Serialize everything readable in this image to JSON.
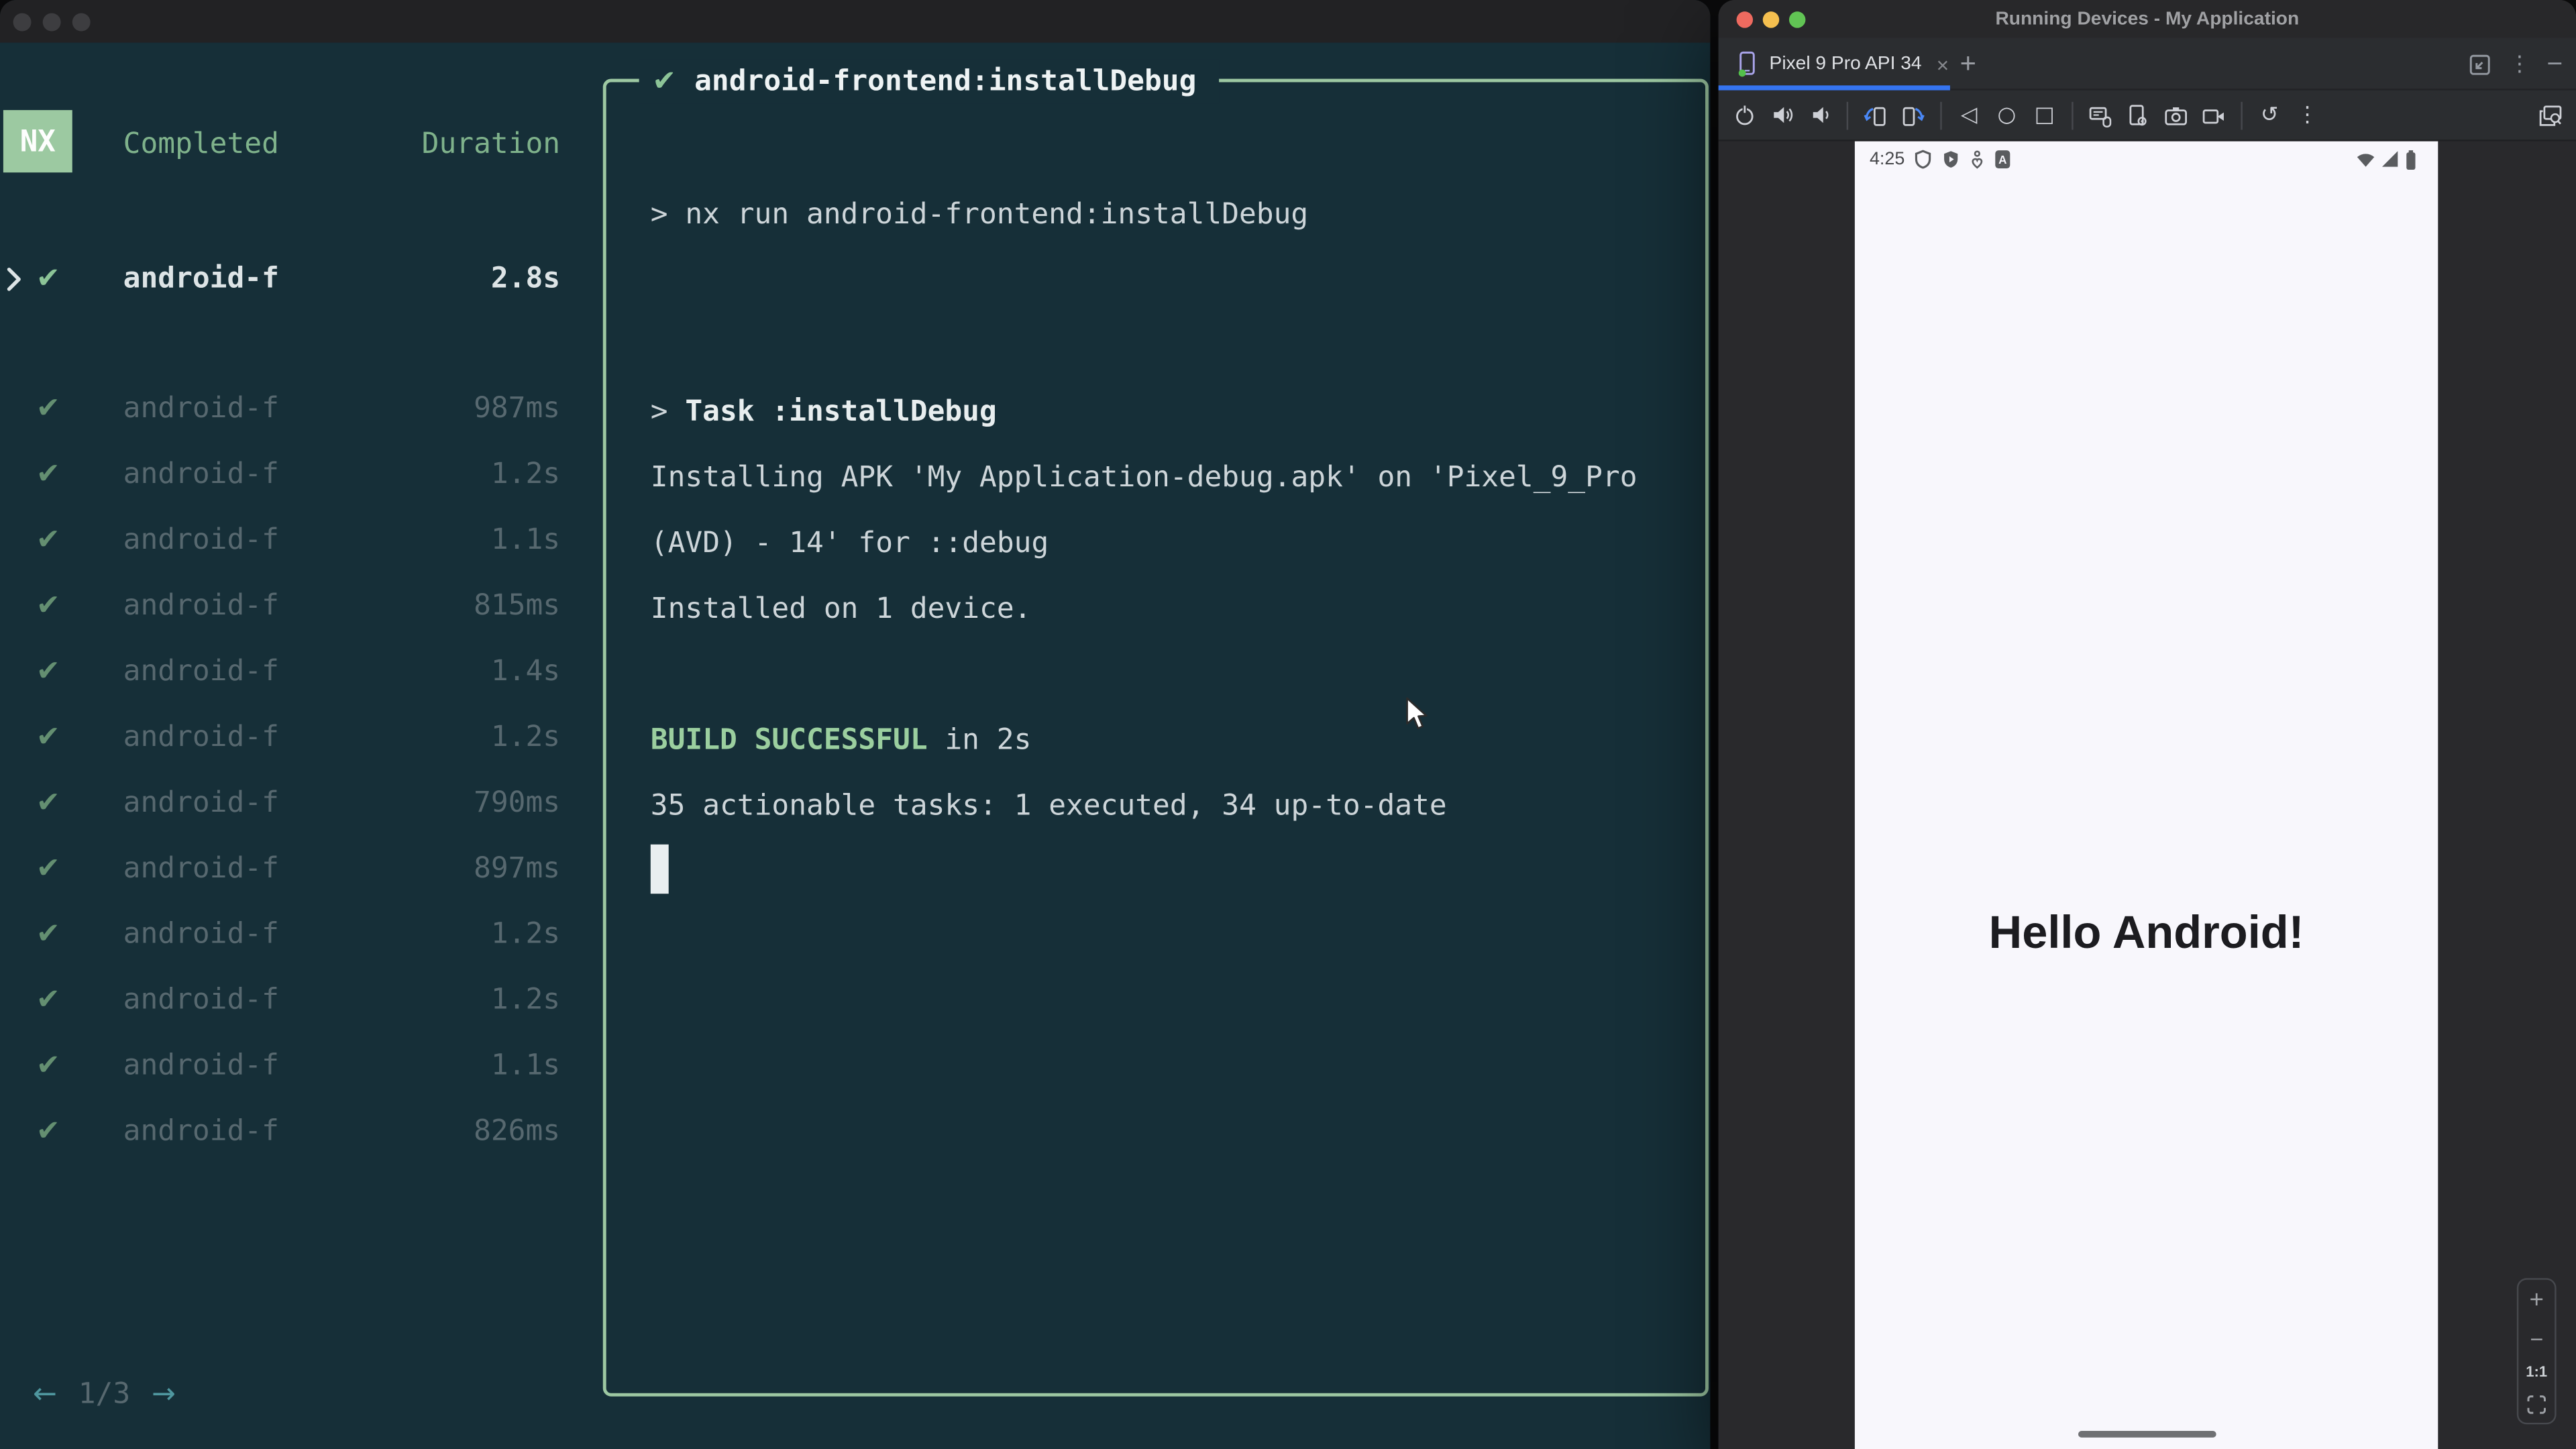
{
  "terminal": {
    "logo": "NX",
    "check_glyph": "✔",
    "header": {
      "completed": "Completed",
      "duration": "Duration"
    },
    "focused": {
      "name": "android-f",
      "duration": "2.8s"
    },
    "tasks": [
      {
        "name": "android-f",
        "duration": "987ms"
      },
      {
        "name": "android-f",
        "duration": "1.2s"
      },
      {
        "name": "android-f",
        "duration": "1.1s"
      },
      {
        "name": "android-f",
        "duration": "815ms"
      },
      {
        "name": "android-f",
        "duration": "1.4s"
      },
      {
        "name": "android-f",
        "duration": "1.2s"
      },
      {
        "name": "android-f",
        "duration": "790ms"
      },
      {
        "name": "android-f",
        "duration": "897ms"
      },
      {
        "name": "android-f",
        "duration": "1.2s"
      },
      {
        "name": "android-f",
        "duration": "1.2s"
      },
      {
        "name": "android-f",
        "duration": "1.1s"
      },
      {
        "name": "android-f",
        "duration": "826ms"
      }
    ],
    "pagination": {
      "prev": "←",
      "current": "1/3",
      "next": "→"
    },
    "output": {
      "title": "android-frontend:installDebug",
      "prompt": ">",
      "command": "nx run android-frontend:installDebug",
      "task_line": "Task :installDebug",
      "install_line1": "Installing APK 'My Application-debug.apk' on 'Pixel_9_Pro",
      "install_line2": "(AVD) - 14' for ::debug",
      "install_line3": "Installed on 1 device.",
      "build_status": "BUILD SUCCESSFUL",
      "build_suffix": "in 2s",
      "summary": "35 actionable tasks: 1 executed, 34 up-to-date"
    },
    "colors": {
      "background": "#162f38",
      "accent_green": "#9dc8a2",
      "dim_text": "#57686f",
      "bright_text": "#dde4e6",
      "teal_arrow": "#4f979f"
    }
  },
  "studio": {
    "window_title": "Running Devices - My Application",
    "tab": {
      "label": "Pixel 9 Pro API 34",
      "close_glyph": "×",
      "add_glyph": "+"
    },
    "window_controls": {
      "more_glyph": "⋮",
      "minimize_glyph": "─"
    },
    "toolbar": {
      "icons": [
        "power",
        "volume-up",
        "volume-down",
        "rotate-left",
        "rotate-right",
        "back",
        "home",
        "overview",
        "hardware-input",
        "device-settings",
        "screenshot-camera",
        "screen-record",
        "reset",
        "more-options",
        "device-search"
      ],
      "back_glyph": "◁",
      "home_glyph": "○",
      "overview_glyph": "□",
      "reset_glyph": "↺",
      "more_glyph": "⋮"
    },
    "device": {
      "clock": "4:25",
      "message": "Hello Android!"
    },
    "zoom_controls": {
      "zoom_in": "+",
      "zoom_out": "−",
      "actual_size": "1:1"
    },
    "colors": {
      "tab_underline": "#3574f0",
      "titlebar": "#28282a",
      "toolbar_bg": "#2b2d30",
      "phone_bg": "#f8f7fc",
      "traffic_red": "#ee6a5f",
      "traffic_yellow": "#f5bf4f",
      "traffic_green": "#61c454"
    }
  }
}
